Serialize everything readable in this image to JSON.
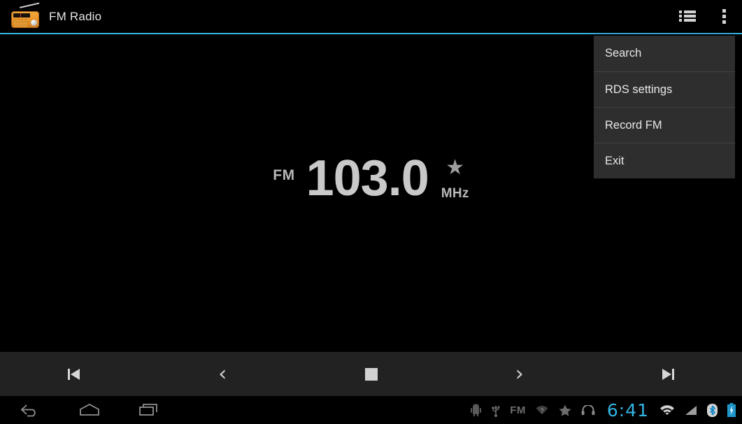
{
  "app": {
    "title": "FM Radio",
    "icon": "fm-radio-icon",
    "accent_color": "#33b5e5",
    "background_color": "#000000"
  },
  "action_bar": {
    "station_list_icon": "list-icon",
    "overflow_icon": "overflow-menu-icon"
  },
  "overflow_menu": {
    "visible": true,
    "background_color": "#2e2e2e",
    "items": [
      {
        "label": "Search"
      },
      {
        "label": "RDS settings"
      },
      {
        "label": "Record FM"
      },
      {
        "label": "Exit"
      }
    ]
  },
  "tuner": {
    "band_label": "FM",
    "frequency": "103.0",
    "unit": "MHz",
    "favorite_icon": "star-icon",
    "favorite_star": "★",
    "text_color": "#c9c9c9"
  },
  "controls": {
    "background_color": "#222222",
    "buttons": [
      {
        "name": "skip-previous-button",
        "icon": "skip-previous-icon",
        "glyph": ""
      },
      {
        "name": "tune-down-button",
        "icon": "chevron-left-icon",
        "glyph": "‹"
      },
      {
        "name": "stop-button",
        "icon": "stop-icon",
        "glyph": ""
      },
      {
        "name": "tune-up-button",
        "icon": "chevron-right-icon",
        "glyph": "›"
      },
      {
        "name": "skip-next-button",
        "icon": "skip-next-icon",
        "glyph": ""
      }
    ]
  },
  "system_bar": {
    "nav_keys": [
      {
        "name": "back-button",
        "icon": "back-icon"
      },
      {
        "name": "home-button",
        "icon": "home-icon"
      },
      {
        "name": "recents-button",
        "icon": "recents-icon"
      }
    ],
    "notification_icons": [
      {
        "name": "android-debug-icon",
        "label": ""
      },
      {
        "name": "usb-icon",
        "label": ""
      },
      {
        "name": "fm-running-icon",
        "label": "FM"
      },
      {
        "name": "wifi-unknown-icon",
        "label": ""
      },
      {
        "name": "star-notification-icon",
        "label": "★"
      },
      {
        "name": "headset-icon",
        "label": ""
      }
    ],
    "clock": "6:41",
    "clock_color": "#33b5e5",
    "status_icons": [
      {
        "name": "wifi-icon"
      },
      {
        "name": "signal-icon"
      },
      {
        "name": "bluetooth-icon"
      },
      {
        "name": "battery-charging-icon"
      }
    ]
  }
}
